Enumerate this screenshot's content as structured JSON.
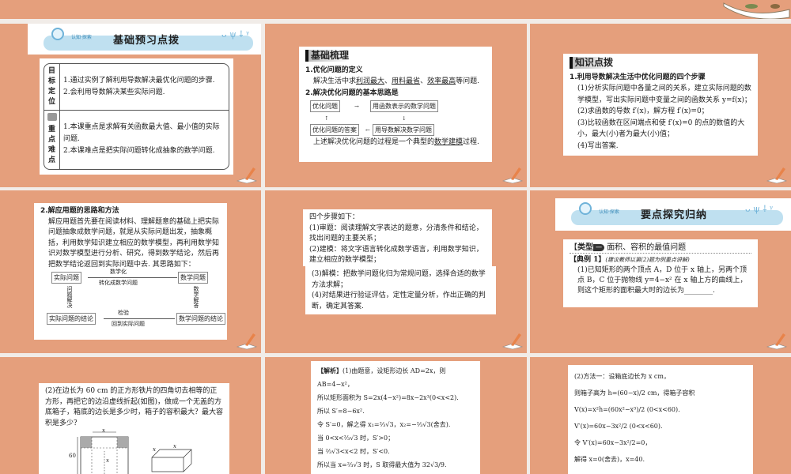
{
  "slide1": {
    "header_small": "认知·探索",
    "header_title": "基础预习点拨",
    "row1_label": [
      "目",
      "标",
      "定",
      "位"
    ],
    "row1_items": [
      "1.通过实例了解利用导数解决最优化问题的步骤.",
      "2.会利用导数解决某些实际问题."
    ],
    "row2_label": [
      "重",
      "点",
      "难",
      "点"
    ],
    "row2_items": [
      "1.本课重点是求解有关函数最大值、最小值的实际问题.",
      "2.本课难点是把实际问题转化成抽象的数学问题."
    ]
  },
  "slide2": {
    "title": "基础梳理",
    "h1": "1.优化问题的定义",
    "p1_prefix": "解决生活中求",
    "p1_u1": "利润最大",
    "p1_sep1": "、",
    "p1_u2": "用料最省",
    "p1_sep2": "、",
    "p1_u3": "效率最高",
    "p1_suffix": "等问题.",
    "h2": "2.解决优化问题的基本思路是",
    "flow": [
      "优化问题",
      "用函数表示的数学问题",
      "用导数解决数学问题",
      "优化问题的答案"
    ],
    "p2_prefix": "上述解决优化问题的过程是一个典型的",
    "p2_u": "数学建模",
    "p2_suffix": "过程."
  },
  "slide3": {
    "title": "知识点拨",
    "h1": "1.利用导数解决生活中优化问题的四个步骤",
    "steps": [
      "(1)分析实际问题中各量之间的关系，建立实际问题的数学模型，写出实际问题中变量之间的函数关系 y=f(x)；",
      "(2)求函数的导数 f′(x)，解方程 f′(x)=0；",
      "(3)比较函数在区间端点和使 f′(x)=0 的点的数值的大小，最大(小)者为最大(小)值；",
      "(4)写出答案."
    ]
  },
  "slide4": {
    "h2": "2.解应用题的思路和方法",
    "para": "解应用题首先要在阅读材料、理解题意的基础上把实际问题抽象成数学问题，就是从实际问题出发，抽象概括，利用数学知识建立相应的数学模型，再利用数学知识对数学模型进行分析、研究，得到数学结论，然后再把数学结论返回到实际问题中去. 其思路如下：",
    "flow": {
      "tl": "实际问题",
      "tr": "数学问题",
      "br": "数学问题的结论",
      "bl": "实际问题的结论",
      "top_above": "数学化",
      "top_below": "转化成数学问题",
      "right": "数学解答",
      "bottom_above": "检验",
      "bottom_below": "回到实际问题",
      "left": "问题解决"
    }
  },
  "slide5": {
    "lines1": [
      "四个步骤如下：",
      "(1)审题：阅读理解文字表达的题意，分清条件和结论，找出问题的主要关系；",
      "(2)建模：将文字语言转化成数学语言，利用数学知识，建立相应的数学模型；"
    ],
    "lines2": [
      "(3)解模：把数学问题化归为常规问题，选择合适的数学方法求解；",
      "(4)对结果进行验证评估，定性定量分析，作出正确的判断，确定其答案."
    ]
  },
  "slide6": {
    "header_small": "认知·探索",
    "header_title": "要点探究归纳",
    "type_label": "类型",
    "type_num": "一",
    "type_title": "面积、容积的最值问题",
    "example_label": "【典例 1】",
    "example_note": "(建议教师以第(2)题为例重点讲解)",
    "example_text": "(1)已知矩形的两个顶点 A，D 位于 x 轴上，另两个顶点 B，C 位于抛物线 y=4−x² 在 x 轴上方的曲线上，则这个矩形的面积最大时的边长为________."
  },
  "slide7": {
    "text": "(2)在边长为 60 cm 的正方形铁片的四角切去相等的正方形，再把它的边沿虚线折起(如图)，做成一个无盖的方底箱子，箱底的边长是多少时，箱子的容积最大？最大容积是多少？",
    "fig_x_top": "x",
    "fig_60": "60",
    "fig_x_mid": "x",
    "fig_box_x1": "x",
    "fig_box_x2": "x"
  },
  "slide8": {
    "label": "【解析】",
    "lines": [
      "(1)由题意，设矩形边长 AD=2x，则 AB=4−x²，",
      "所以矩形面积为 S=2x(4−x²)=8x−2x³(0<x<2).",
      "所以 S′=8−6x².",
      "令 S′=0，解之得 x₁=⅔√3，x₂=−⅔√3(舍去).",
      "当 0<x<⅔√3 时，S′>0；",
      "当 ⅔√3<x<2 时，S′<0.",
      "所以当 x=⅔√3 时，S 取得最大值为 32√3/9."
    ]
  },
  "slide9": {
    "lines": [
      "(2)方法一：设箱底边长为 x cm，",
      "则箱子高为 h=(60−x)/2 cm，得箱子容积",
      "V(x)=x²h=(60x²−x³)/2 (0<x<60).",
      "V′(x)=60x−3x²/2 (0<x<60).",
      "令 V′(x)=60x−3x²/2=0，",
      "解得 x=0(舍去)，x=40."
    ]
  },
  "colors": {
    "slide_bg": "#e59f7c",
    "gap": "#f1ece8",
    "ribbon": "#bfe0f0"
  }
}
